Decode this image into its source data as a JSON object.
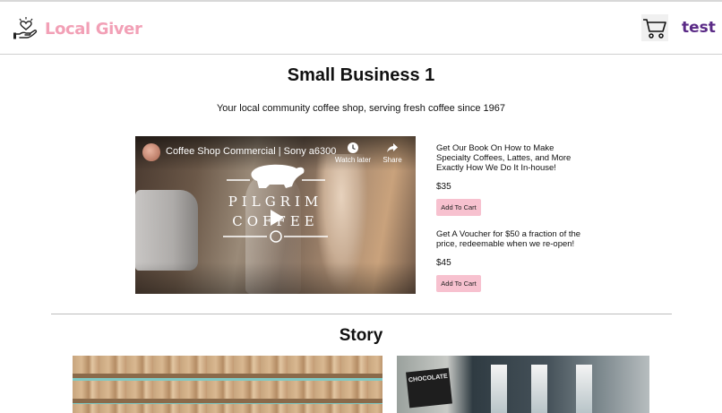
{
  "header": {
    "brand_name": "Local Giver",
    "brand_icon": "heart-in-hand-icon",
    "cart_icon": "shopping-cart-icon",
    "user_name": "test",
    "brand_color": "#f2a0b6",
    "user_color": "#5a2a86"
  },
  "business": {
    "name": "Small Business 1",
    "tagline": "Your local community coffee shop, serving fresh coffee since 1967"
  },
  "video": {
    "title": "Coffee Shop Commercial | Sony a6300",
    "watch_later_label": "Watch later",
    "share_label": "Share",
    "overlay_line1": "PILGRIM",
    "overlay_line2": "COFFEE"
  },
  "products": [
    {
      "name": "Get Our Book On How to Make Specialty Coffees, Lattes, and More Exactly How We Do It In-house!",
      "price": "$35",
      "button_label": "Add To Cart"
    },
    {
      "name": "Get A Voucher for $50 a fraction of the price, redeemable when we re-open!",
      "price": "$45",
      "button_label": "Add To Cart"
    }
  ],
  "story": {
    "heading": "Story",
    "photo2_sign_text": "CHOCOLATE"
  },
  "colors": {
    "button_bg": "#f7c1cf"
  }
}
